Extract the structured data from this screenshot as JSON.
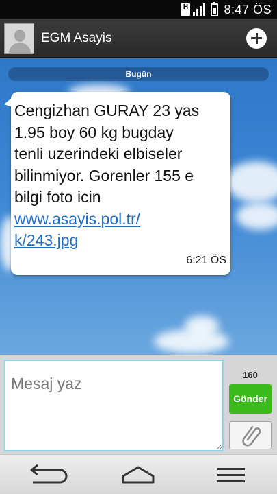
{
  "status_bar": {
    "network_badge": "H",
    "time": "8:47 ÖS",
    "icons": [
      "network-type-icon",
      "signal-icon",
      "battery-icon"
    ]
  },
  "header": {
    "contact_name": "EGM Asayis",
    "icons": [
      "contact-avatar-icon",
      "add-icon"
    ]
  },
  "conversation": {
    "date_label": "Bugün",
    "messages": [
      {
        "text_lines": [
          "Cengizhan GURAY 23 yas",
          "1.95 boy 60 kg bugday",
          "tenli uzerindeki elbiseler",
          "bilinmiyor. Gorenler 155 e",
          "bilgi foto icin"
        ],
        "link_lines": [
          "www.asayis.pol.tr/",
          "k/243.jpg"
        ],
        "time": "6:21 ÖS"
      }
    ]
  },
  "compose": {
    "placeholder": "Mesaj yaz",
    "char_count": "160",
    "send_label": "Gönder",
    "icons": [
      "paperclip-icon"
    ]
  },
  "nav_bar": {
    "icons": [
      "back-icon",
      "home-icon",
      "menu-icon"
    ]
  },
  "colors": {
    "accent_send": "#3bbb1b",
    "link": "#1f6fc6",
    "input_focus_border": "#8fd1e8",
    "wallpaper": "#3c86d4"
  }
}
